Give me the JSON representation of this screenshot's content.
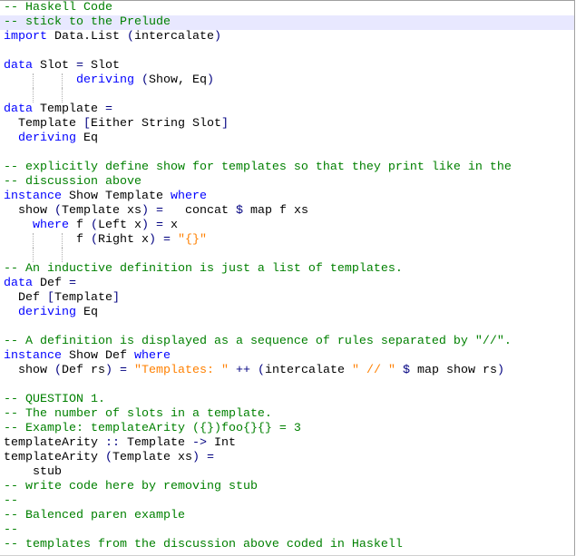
{
  "editor": {
    "language": "Haskell",
    "current_line": 2,
    "colors": {
      "comment": "#008000",
      "keyword": "#0000ff",
      "operator": "#000080",
      "string": "#ff8000",
      "current_line_bg": "#e8e8ff"
    },
    "lines": [
      {
        "tokens": [
          [
            "c",
            "-- Haskell Code"
          ]
        ]
      },
      {
        "tokens": [
          [
            "c",
            "-- stick to the Prelude"
          ]
        ]
      },
      {
        "tokens": [
          [
            "k",
            "import"
          ],
          [
            "t",
            " Data.List "
          ],
          [
            "o",
            "("
          ],
          [
            "t",
            "intercalate"
          ],
          [
            "o",
            ")"
          ]
        ]
      },
      {
        "tokens": []
      },
      {
        "tokens": [
          [
            "k",
            "data"
          ],
          [
            "t",
            " Slot "
          ],
          [
            "o",
            "="
          ],
          [
            "t",
            " Slot"
          ]
        ]
      },
      {
        "tokens": [
          [
            "t",
            "          "
          ],
          [
            "k",
            "deriving"
          ],
          [
            "t",
            " "
          ],
          [
            "o",
            "("
          ],
          [
            "t",
            "Show, Eq"
          ],
          [
            "o",
            ")"
          ]
        ],
        "guides": true
      },
      {
        "tokens": [],
        "guides": true
      },
      {
        "tokens": [
          [
            "k",
            "data"
          ],
          [
            "t",
            " Template "
          ],
          [
            "o",
            "="
          ]
        ]
      },
      {
        "tokens": [
          [
            "t",
            "  Template "
          ],
          [
            "o",
            "["
          ],
          [
            "t",
            "Either String Slot"
          ],
          [
            "o",
            "]"
          ]
        ]
      },
      {
        "tokens": [
          [
            "t",
            "  "
          ],
          [
            "k",
            "deriving"
          ],
          [
            "t",
            " Eq"
          ]
        ]
      },
      {
        "tokens": []
      },
      {
        "tokens": [
          [
            "c",
            "-- explicitly define show for templates so that they print like in the"
          ]
        ]
      },
      {
        "tokens": [
          [
            "c",
            "-- discussion above"
          ]
        ]
      },
      {
        "tokens": [
          [
            "k",
            "instance"
          ],
          [
            "t",
            " Show Template "
          ],
          [
            "k",
            "where"
          ]
        ]
      },
      {
        "tokens": [
          [
            "t",
            "  show "
          ],
          [
            "o",
            "("
          ],
          [
            "t",
            "Template xs"
          ],
          [
            "o",
            ")"
          ],
          [
            "t",
            " "
          ],
          [
            "o",
            "="
          ],
          [
            "t",
            "   concat "
          ],
          [
            "o",
            "$"
          ],
          [
            "t",
            " map f xs"
          ]
        ]
      },
      {
        "tokens": [
          [
            "t",
            "    "
          ],
          [
            "k",
            "where"
          ],
          [
            "t",
            " f "
          ],
          [
            "o",
            "("
          ],
          [
            "t",
            "Left x"
          ],
          [
            "o",
            ")"
          ],
          [
            "t",
            " "
          ],
          [
            "o",
            "="
          ],
          [
            "t",
            " x"
          ]
        ]
      },
      {
        "tokens": [
          [
            "t",
            "          f "
          ],
          [
            "o",
            "("
          ],
          [
            "t",
            "Right x"
          ],
          [
            "o",
            ")"
          ],
          [
            "t",
            " "
          ],
          [
            "o",
            "="
          ],
          [
            "t",
            " "
          ],
          [
            "s",
            "\"{}\""
          ]
        ],
        "guides": true
      },
      {
        "tokens": [],
        "guides": true
      },
      {
        "tokens": [
          [
            "c",
            "-- An inductive definition is just a list of templates."
          ]
        ]
      },
      {
        "tokens": [
          [
            "k",
            "data"
          ],
          [
            "t",
            " Def "
          ],
          [
            "o",
            "="
          ]
        ]
      },
      {
        "tokens": [
          [
            "t",
            "  Def "
          ],
          [
            "o",
            "["
          ],
          [
            "t",
            "Template"
          ],
          [
            "o",
            "]"
          ]
        ]
      },
      {
        "tokens": [
          [
            "t",
            "  "
          ],
          [
            "k",
            "deriving"
          ],
          [
            "t",
            " Eq"
          ]
        ]
      },
      {
        "tokens": []
      },
      {
        "tokens": [
          [
            "c",
            "-- A definition is displayed as a sequence of rules separated by \"//\"."
          ]
        ]
      },
      {
        "tokens": [
          [
            "k",
            "instance"
          ],
          [
            "t",
            " Show Def "
          ],
          [
            "k",
            "where"
          ]
        ]
      },
      {
        "tokens": [
          [
            "t",
            "  show "
          ],
          [
            "o",
            "("
          ],
          [
            "t",
            "Def rs"
          ],
          [
            "o",
            ")"
          ],
          [
            "t",
            " "
          ],
          [
            "o",
            "="
          ],
          [
            "t",
            " "
          ],
          [
            "s",
            "\"Templates: \""
          ],
          [
            "t",
            " "
          ],
          [
            "o",
            "++"
          ],
          [
            "t",
            " "
          ],
          [
            "o",
            "("
          ],
          [
            "t",
            "intercalate "
          ],
          [
            "s",
            "\" // \""
          ],
          [
            "t",
            " "
          ],
          [
            "o",
            "$"
          ],
          [
            "t",
            " map show rs"
          ],
          [
            "o",
            ")"
          ]
        ]
      },
      {
        "tokens": []
      },
      {
        "tokens": [
          [
            "c",
            "-- QUESTION 1."
          ]
        ]
      },
      {
        "tokens": [
          [
            "c",
            "-- The number of slots in a template."
          ]
        ]
      },
      {
        "tokens": [
          [
            "c",
            "-- Example: templateArity ({})foo{}{} = 3"
          ]
        ]
      },
      {
        "tokens": [
          [
            "t",
            "templateArity "
          ],
          [
            "o",
            "::"
          ],
          [
            "t",
            " Template "
          ],
          [
            "o",
            "->"
          ],
          [
            "t",
            " Int"
          ]
        ]
      },
      {
        "tokens": [
          [
            "t",
            "templateArity "
          ],
          [
            "o",
            "("
          ],
          [
            "t",
            "Template xs"
          ],
          [
            "o",
            ")"
          ],
          [
            "t",
            " "
          ],
          [
            "o",
            "="
          ]
        ]
      },
      {
        "tokens": [
          [
            "t",
            "    stub"
          ]
        ]
      },
      {
        "tokens": [
          [
            "c",
            "-- write code here by removing stub"
          ]
        ]
      },
      {
        "tokens": [
          [
            "c",
            "--"
          ]
        ]
      },
      {
        "tokens": [
          [
            "c",
            "-- Balenced paren example"
          ]
        ]
      },
      {
        "tokens": [
          [
            "c",
            "--"
          ]
        ]
      },
      {
        "tokens": [
          [
            "c",
            "-- templates from the discussion above coded in Haskell"
          ]
        ]
      }
    ]
  }
}
